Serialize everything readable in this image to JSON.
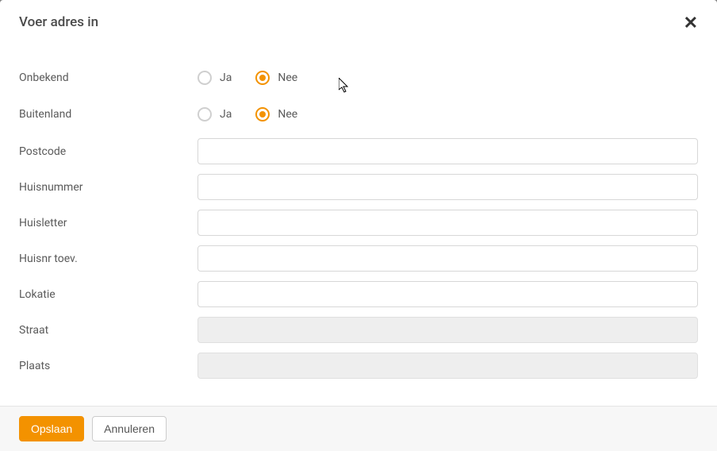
{
  "modal": {
    "title": "Voer adres in"
  },
  "fields": {
    "onbekend": {
      "label": "Onbekend",
      "ja": "Ja",
      "nee": "Nee",
      "selected": "nee"
    },
    "buitenland": {
      "label": "Buitenland",
      "ja": "Ja",
      "nee": "Nee",
      "selected": "nee"
    },
    "postcode": {
      "label": "Postcode",
      "value": ""
    },
    "huisnummer": {
      "label": "Huisnummer",
      "value": ""
    },
    "huisletter": {
      "label": "Huisletter",
      "value": ""
    },
    "huisnr_toev": {
      "label": "Huisnr toev.",
      "value": ""
    },
    "lokatie": {
      "label": "Lokatie",
      "value": ""
    },
    "straat": {
      "label": "Straat",
      "value": ""
    },
    "plaats": {
      "label": "Plaats",
      "value": ""
    }
  },
  "footer": {
    "save": "Opslaan",
    "cancel": "Annuleren"
  },
  "colors": {
    "accent": "#f39200"
  }
}
